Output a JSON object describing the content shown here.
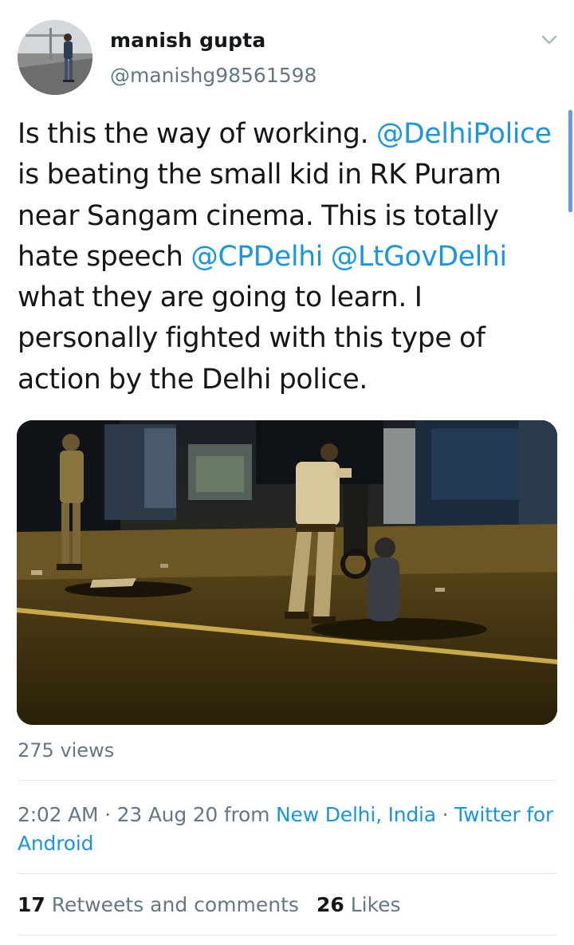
{
  "user": {
    "display_name": "manish gupta",
    "handle": "@manishg98561598"
  },
  "tweet": {
    "segments": [
      {
        "text": "Is this the way of working. ",
        "type": "text"
      },
      {
        "text": "@DelhiPolice",
        "type": "mention"
      },
      {
        "text": " is beating the small kid in RK Puram near Sangam cinema. This is totally hate speech ",
        "type": "text"
      },
      {
        "text": "@CPDelhi",
        "type": "mention"
      },
      {
        "text": " ",
        "type": "text"
      },
      {
        "text": "@LtGovDelhi",
        "type": "mention"
      },
      {
        "text": " what they are going to learn. I personally fighted with this type of action by the Delhi police.",
        "type": "text"
      }
    ]
  },
  "views": "275 views",
  "meta": {
    "time": "2:02 AM",
    "sep1": " · ",
    "date": "23 Aug 20",
    "from": " from ",
    "location": "New Delhi, India",
    "sep2": " · ",
    "client": "Twitter for Android"
  },
  "stats": {
    "retweets_count": "17",
    "retweets_label": "Retweets and comments",
    "likes_count": "26",
    "likes_label": "Likes"
  },
  "icons": {
    "menu": "chevron-down-icon"
  },
  "colors": {
    "link": "#1b95e0",
    "secondary": "#657786",
    "divider": "#e1e8ed"
  }
}
